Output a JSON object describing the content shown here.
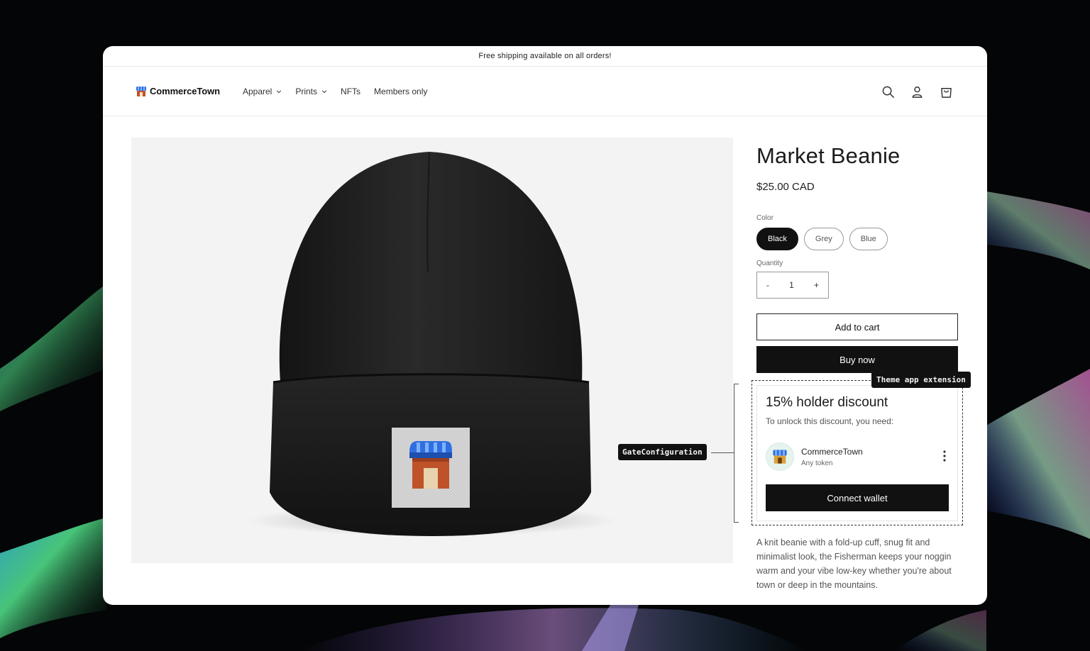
{
  "announcement": "Free shipping available on all orders!",
  "brand": {
    "name": "CommerceTown"
  },
  "nav": {
    "items": [
      {
        "label": "Apparel",
        "has_menu": true
      },
      {
        "label": "Prints",
        "has_menu": true
      },
      {
        "label": "NFTs",
        "has_menu": false
      },
      {
        "label": "Members only",
        "has_menu": false
      }
    ]
  },
  "header_icons": [
    "search-icon",
    "account-icon",
    "cart-icon"
  ],
  "product": {
    "title": "Market Beanie",
    "price": "$25.00 CAD",
    "color_label": "Color",
    "colors": [
      {
        "label": "Black",
        "selected": true
      },
      {
        "label": "Grey",
        "selected": false
      },
      {
        "label": "Blue",
        "selected": false
      }
    ],
    "quantity_label": "Quantity",
    "quantity": {
      "decrement": "-",
      "value": "1",
      "increment": "+"
    },
    "add_to_cart": "Add to cart",
    "buy_now": "Buy now",
    "description": "A knit beanie with a fold-up cuff, snug fit and minimalist look, the Fisherman keeps your noggin warm and your vibe low-key whether you're about town or deep in the mountains."
  },
  "annotations": {
    "gate_configuration": "GateConfiguration",
    "theme_app_extension": "Theme app extension"
  },
  "gate": {
    "title": "15% holder discount",
    "subtitle": "To unlock this discount, you need:",
    "requirement": {
      "name": "CommerceTown",
      "detail": "Any token"
    },
    "connect_button": "Connect wallet"
  },
  "colors": {
    "backdrop": "#050607",
    "primary": "#111111",
    "page": "#ffffff"
  }
}
